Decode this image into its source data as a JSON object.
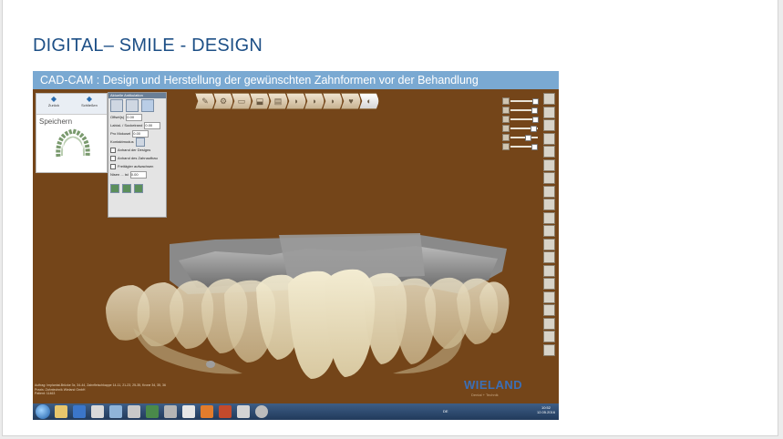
{
  "slide": {
    "title": "DIGITAL– SMILE - DESIGN"
  },
  "screenshot": {
    "banner": "CAD-CAM : Design und Herstellung der gewünschten Zahnformen vor der Behandlung",
    "left_panel": {
      "back_label": "Zurück",
      "close_label": "Schließen",
      "save_label": "Speichern"
    },
    "props_panel": {
      "header": "Aktuelle Antikulation",
      "rows": [
        {
          "label": "Offset(s)",
          "value": "0.00"
        },
        {
          "label": "Labial- / Sockelrand",
          "value": "0.00"
        },
        {
          "label": "Pro Mokusel",
          "value": "0.00"
        }
      ],
      "section": "Kontaktmodus",
      "checks": [
        "Anhand der Designs",
        "Anhand des Zahnaufbau",
        "Freitägler aufwachsen"
      ],
      "extra_rows": [
        {
          "label": "Nisen ... ist",
          "value": "0.00"
        }
      ]
    },
    "toolbar_icons": [
      "tool-1",
      "tool-2",
      "tool-3",
      "tool-4",
      "tool-5",
      "tool-6",
      "tool-7",
      "tool-8",
      "tool-9",
      "tool-10"
    ],
    "slider_levels": [
      0.9,
      0.85,
      0.9,
      0.8,
      0.6,
      0.85
    ],
    "right_toolbar_count": 20,
    "status_lines": [
      "Auftrag:  Implantat-Brücke 3x, 34-44, Zahnfleischkappe 14-11, 21-23, 25-35, Krone 34, 35, 36",
      "Praxis:    Zahntechnik Wieland GmbH",
      "Patient:   11463"
    ],
    "logo": "WIELAND",
    "logo_sub": "Dental + Technik",
    "taskbar": {
      "lang": "DE",
      "time": "10:52",
      "date": "12.05.2016"
    }
  },
  "colors": {
    "title": "#1d4f86",
    "banner": "#7aa9d2",
    "viewport": "#744519",
    "logo": "#3b6fb6"
  }
}
